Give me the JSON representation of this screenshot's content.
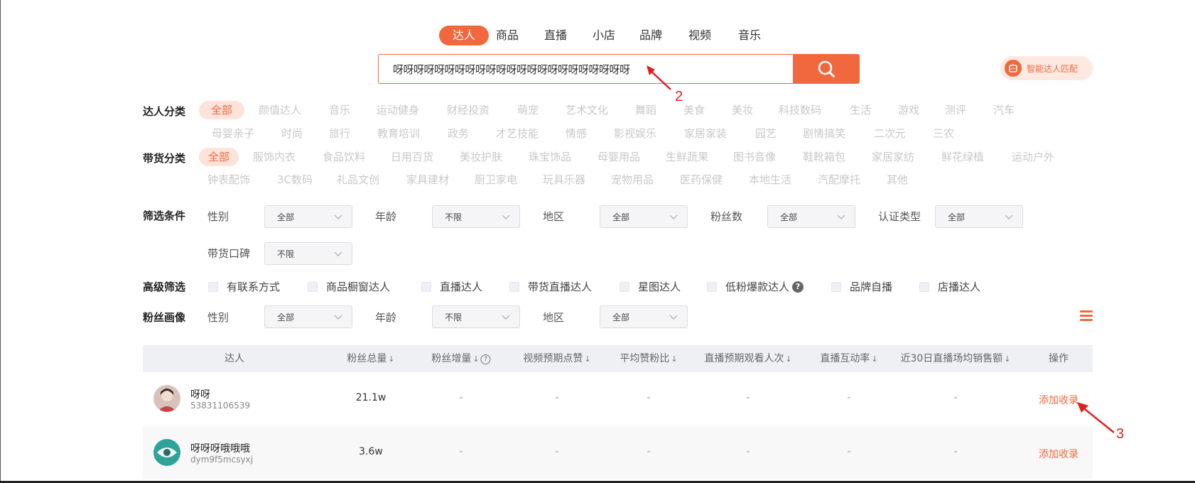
{
  "tabs": [
    "达人",
    "商品",
    "直播",
    "小店",
    "品牌",
    "视频",
    "音乐"
  ],
  "search": {
    "value": "呀呀呀呀呀呀呀呀呀呀呀呀呀呀呀呀呀呀呀呀呀呀呀",
    "button_icon": "search-icon"
  },
  "match_button": {
    "label": "智能达人匹配",
    "icon": "robot-icon"
  },
  "annotations": {
    "search": "2",
    "action": "3"
  },
  "talent_category": {
    "label": "达人分类",
    "items": [
      "全部",
      "颜值达人",
      "音乐",
      "运动健身",
      "财经投资",
      "萌宠",
      "艺术文化",
      "舞蹈",
      "美食",
      "美妆",
      "科技数码",
      "生活",
      "游戏",
      "测评",
      "汽车",
      "母婴亲子",
      "时尚",
      "旅行",
      "教育培训",
      "政务",
      "才艺技能",
      "情感",
      "影视娱乐",
      "家居家装",
      "园艺",
      "剧情搞笑",
      "二次元",
      "三农"
    ]
  },
  "goods_category": {
    "label": "带货分类",
    "items": [
      "全部",
      "服饰内衣",
      "食品饮料",
      "日用百货",
      "美妆护肤",
      "珠宝饰品",
      "母婴用品",
      "生鲜蔬果",
      "图书音像",
      "鞋靴箱包",
      "家居家纺",
      "鲜花绿植",
      "运动户外",
      "钟表配饰",
      "3C数码",
      "礼品文创",
      "家具建材",
      "厨卫家电",
      "玩具乐器",
      "宠物用品",
      "医药保健",
      "本地生活",
      "汽配摩托",
      "其他"
    ]
  },
  "filters": {
    "label": "筛选条件",
    "items": [
      {
        "label": "性别",
        "value": "全部"
      },
      {
        "label": "年龄",
        "value": "不限"
      },
      {
        "label": "地区",
        "value": "全部"
      },
      {
        "label": "粉丝数",
        "value": "全部"
      },
      {
        "label": "认证类型",
        "value": "全部"
      },
      {
        "label": "带货口碑",
        "value": "不限"
      }
    ]
  },
  "advanced": {
    "label": "高级筛选",
    "items": [
      "有联系方式",
      "商品橱窗达人",
      "直播达人",
      "带货直播达人",
      "星图达人",
      "低粉爆款达人",
      "品牌自播",
      "店播达人"
    ]
  },
  "fans_profile": {
    "label": "粉丝画像",
    "items": [
      {
        "label": "性别",
        "value": "全部"
      },
      {
        "label": "年龄",
        "value": "不限"
      },
      {
        "label": "地区",
        "value": "全部"
      }
    ]
  },
  "table": {
    "columns": [
      "达人",
      "粉丝总量",
      "粉丝增量",
      "视频预期点赞",
      "平均赞粉比",
      "直播预期观看人次",
      "直播互动率",
      "近30日直播场均销售额",
      "操作"
    ],
    "sort_glyph": "↓",
    "rows": [
      {
        "name": "呀呀",
        "id": "53831106539",
        "fans": "21.1w",
        "cells": [
          "-",
          "-",
          "-",
          "-",
          "-",
          "-"
        ],
        "action": "添加收录"
      },
      {
        "name": "呀呀呀哦哦哦",
        "id": "dym9f5mcsyxj",
        "fans": "3.6w",
        "cells": [
          "-",
          "-",
          "-",
          "-",
          "-",
          "-"
        ],
        "action": "添加收录"
      }
    ]
  },
  "colors": {
    "accent": "#f1683e",
    "annotation": "#e02020",
    "header_bg": "#eef0f4"
  }
}
